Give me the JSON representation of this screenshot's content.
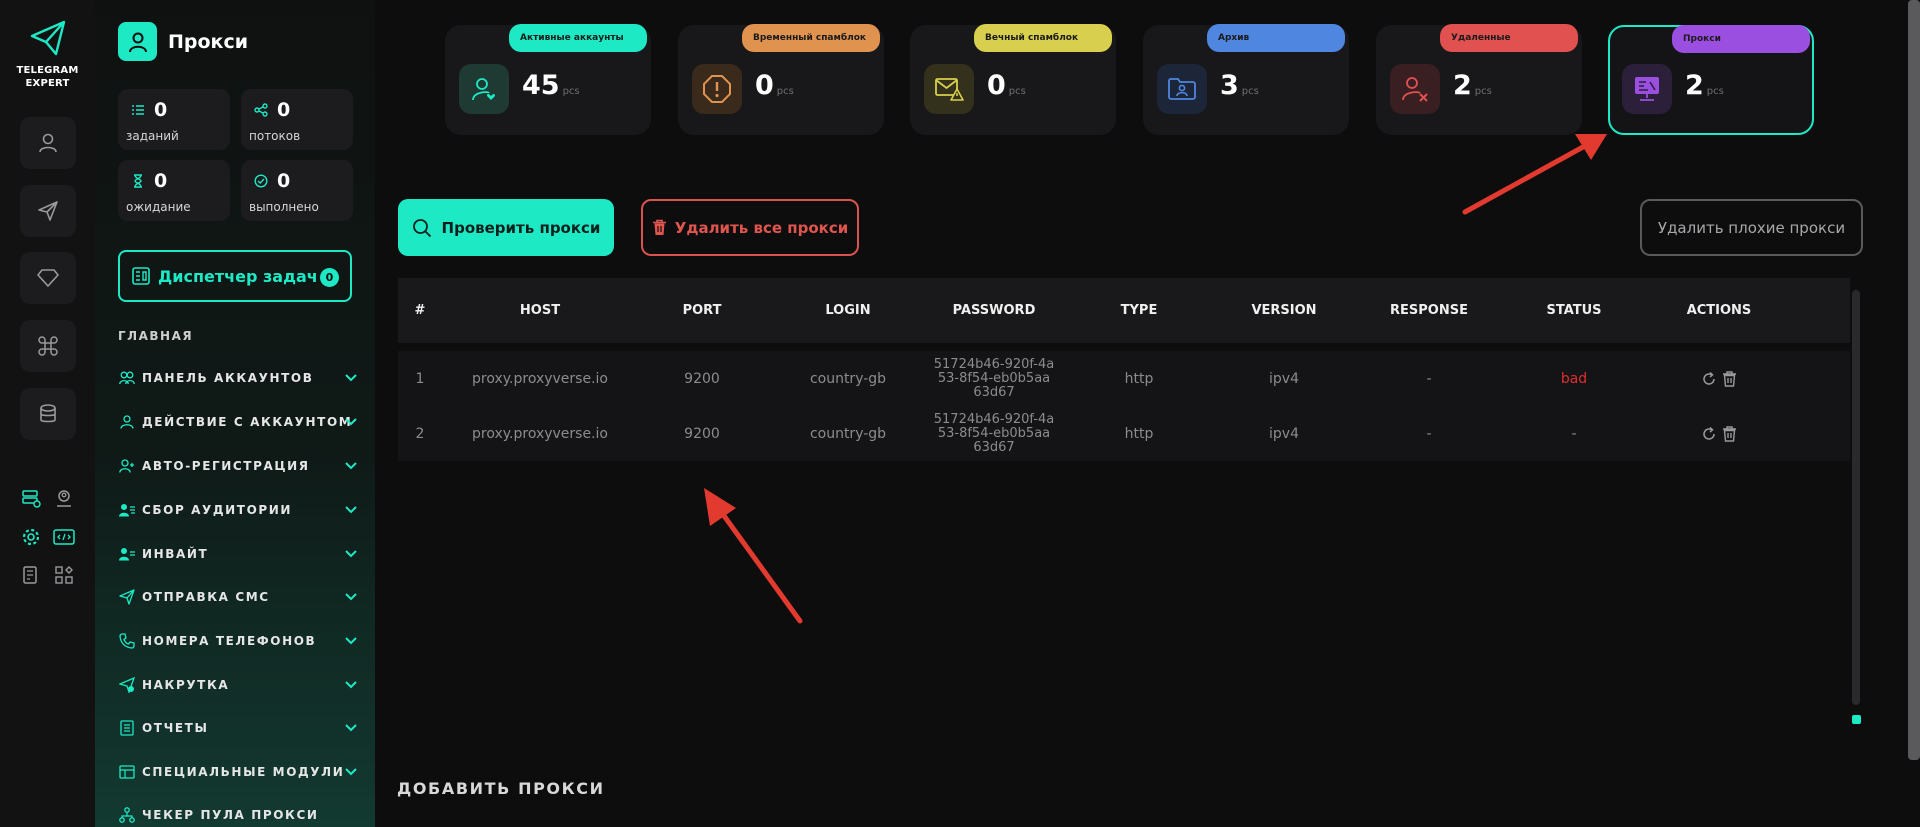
{
  "app": {
    "logo_line1": "TELEGRAM",
    "logo_line2": "EXPERT"
  },
  "page": {
    "title": "Прокси"
  },
  "stats": [
    {
      "value": "0",
      "label": "заданий",
      "icon": "tasks-list-icon"
    },
    {
      "value": "0",
      "label": "потоков",
      "icon": "threads-share-icon"
    },
    {
      "value": "0",
      "label": "ожидание",
      "icon": "hourglass-icon"
    },
    {
      "value": "0",
      "label": "выполнено",
      "icon": "check-circle-icon"
    }
  ],
  "dispatcher": {
    "label": "Диспетчер задач",
    "count": "0"
  },
  "menu": {
    "section": "ГЛАВНАЯ",
    "items": [
      {
        "label": "ПАНЕЛЬ АККАУНТОВ",
        "icon": "users-icon"
      },
      {
        "label": "ДЕЙСТВИЕ С АККАУНТОМ",
        "icon": "user-icon"
      },
      {
        "label": "АВТО-РЕГИСТРАЦИЯ",
        "icon": "user-plus-icon"
      },
      {
        "label": "СБОР АУДИТОРИИ",
        "icon": "user-list-icon"
      },
      {
        "label": "ИНВАЙТ",
        "icon": "invite-icon"
      },
      {
        "label": "ОТПРАВКА СМС",
        "icon": "send-icon"
      },
      {
        "label": "НОМЕРА ТЕЛЕФОНОВ",
        "icon": "phone-icon"
      },
      {
        "label": "НАКРУТКА",
        "icon": "boost-icon"
      },
      {
        "label": "ОТЧЕТЫ",
        "icon": "report-icon"
      },
      {
        "label": "СПЕЦИАЛЬНЫЕ МОДУЛИ",
        "icon": "modules-icon"
      },
      {
        "label": "ЧЕКЕР ПУЛА ПРОКСИ",
        "icon": "network-icon"
      }
    ]
  },
  "cards": [
    {
      "label": "Активные аккаунты",
      "value": "45",
      "unit": "pcs",
      "color": "#1de9c5",
      "icon": "user-heart-icon"
    },
    {
      "label": "Временный спамблок",
      "value": "0",
      "unit": "pcs",
      "color": "#e0924f",
      "icon": "warning-octagon-icon"
    },
    {
      "label": "Вечный спамблок",
      "value": "0",
      "unit": "pcs",
      "color": "#d8cf4e",
      "icon": "mail-warning-icon"
    },
    {
      "label": "Архив",
      "value": "3",
      "unit": "pcs",
      "color": "#4f86e0",
      "icon": "folder-user-icon"
    },
    {
      "label": "Удаленные",
      "value": "2",
      "unit": "pcs",
      "color": "#e05150",
      "icon": "user-x-icon"
    },
    {
      "label": "Прокси",
      "value": "2",
      "unit": "pcs",
      "color": "#9b4fe0",
      "icon": "proxy-server-icon"
    }
  ],
  "buttons": {
    "check": "Проверить прокси",
    "delete_all": "Удалить все прокси",
    "delete_bad": "Удалить плохие прокси"
  },
  "table": {
    "columns": [
      "#",
      "HOST",
      "PORT",
      "LOGIN",
      "PASSWORD",
      "TYPE",
      "VERSION",
      "RESPONSE",
      "STATUS",
      "ACTIONS"
    ],
    "rows": [
      {
        "n": "1",
        "host": "proxy.proxyverse.io",
        "port": "9200",
        "login": "country-gb",
        "password": [
          "51724b46-920f-4a",
          "53-8f54-eb0b5aa",
          "63d67"
        ],
        "type": "http",
        "version": "ipv4",
        "response": "-",
        "status": "bad"
      },
      {
        "n": "2",
        "host": "proxy.proxyverse.io",
        "port": "9200",
        "login": "country-gb",
        "password": [
          "51724b46-920f-4a",
          "53-8f54-eb0b5aa",
          "63d67"
        ],
        "type": "http",
        "version": "ipv4",
        "response": "-",
        "status": "-"
      }
    ]
  },
  "add_section": {
    "title": "ДОБАВИТЬ ПРОКСИ"
  },
  "colors": {
    "accent": "#1de9c5",
    "danger": "#e0564f",
    "annotation": "#e23a2e"
  }
}
